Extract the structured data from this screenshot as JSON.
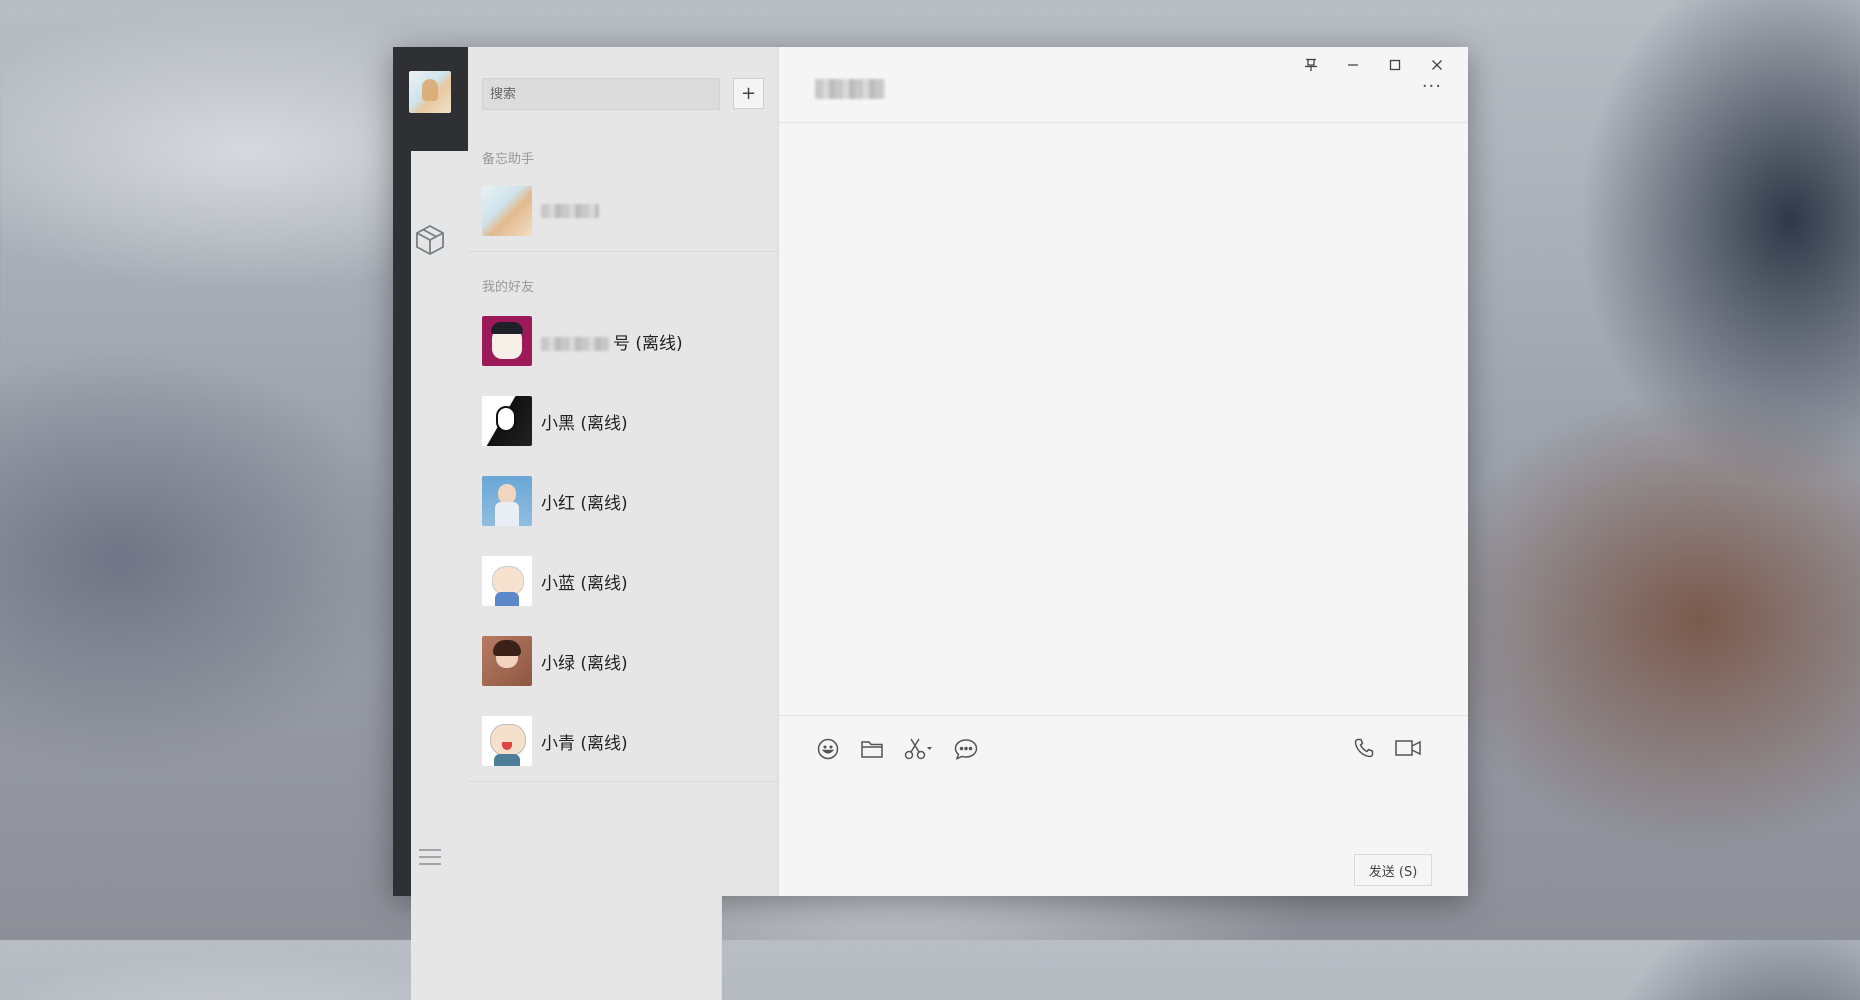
{
  "search": {
    "placeholder": "搜索"
  },
  "add_button": {
    "label": "+"
  },
  "sections": [
    {
      "title": "备忘助手"
    },
    {
      "title": "我的好友"
    }
  ],
  "memo_assistant": {
    "name": ""
  },
  "friends": [
    {
      "name_visible": "号 (离线)",
      "avatar": "avatar-glasses-boy"
    },
    {
      "name_visible": "小黑 (离线)",
      "avatar": "avatar-bw-manga"
    },
    {
      "name_visible": "小红 (离线)",
      "avatar": "avatar-girl-blue-bg"
    },
    {
      "name_visible": "小蓝 (离线)",
      "avatar": "avatar-cartoon-old-man"
    },
    {
      "name_visible": "小绿 (离线)",
      "avatar": "avatar-girl-waving"
    },
    {
      "name_visible": "小青 (离线)",
      "avatar": "avatar-cartoon-crying"
    }
  ],
  "chat": {
    "title": "",
    "more": "···"
  },
  "send_button": {
    "label": "发送 (S)"
  },
  "icons": {
    "rail": [
      "user-avatar",
      "contacts-icon",
      "box-icon",
      "menu-icon"
    ],
    "window": [
      "pin-icon",
      "minimize-icon",
      "maximize-icon",
      "close-icon"
    ],
    "toolbar": [
      "emoji-icon",
      "folder-icon",
      "scissors-icon",
      "chat-bubble-icon"
    ],
    "calls": [
      "phone-icon",
      "video-icon"
    ]
  },
  "colors": {
    "accent_green": "#1aad19",
    "rail_bg": "#2e3033",
    "panel_bg": "#e6e6e6",
    "chat_bg": "#f5f5f5"
  }
}
